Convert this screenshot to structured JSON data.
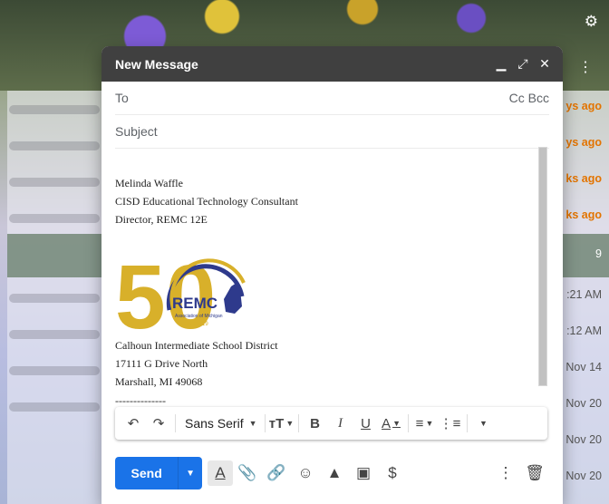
{
  "background": {
    "times": [
      "ys ago",
      "ys ago",
      "ks ago",
      "ks ago",
      "9",
      ":21 AM",
      ":12 AM",
      "Nov 14",
      "Nov 20",
      "Nov 20",
      "Nov 20"
    ]
  },
  "compose": {
    "title": "New Message",
    "to_label": "To",
    "ccbcc_label": "Cc Bcc",
    "subject_placeholder": "Subject",
    "signature": {
      "name": "Melinda Waffle",
      "role": "CISD Educational Technology Consultant",
      "director": "Director, REMC 12E",
      "logo_number": "50",
      "logo_text": "REMC",
      "logo_sub": "Association of Michigan",
      "logo_years": "1969-2019",
      "org": "Calhoun Intermediate School District",
      "street": "17111 G Drive North",
      "city": "Marshall, MI  49068",
      "dashes": "--------------"
    },
    "toolbar": {
      "font": "Sans Serif"
    },
    "send_label": "Send"
  },
  "colors": {
    "accent": "#1a73e8",
    "header": "#404040",
    "logo_gold": "#d8b02a",
    "logo_blue": "#2e3a8c"
  }
}
